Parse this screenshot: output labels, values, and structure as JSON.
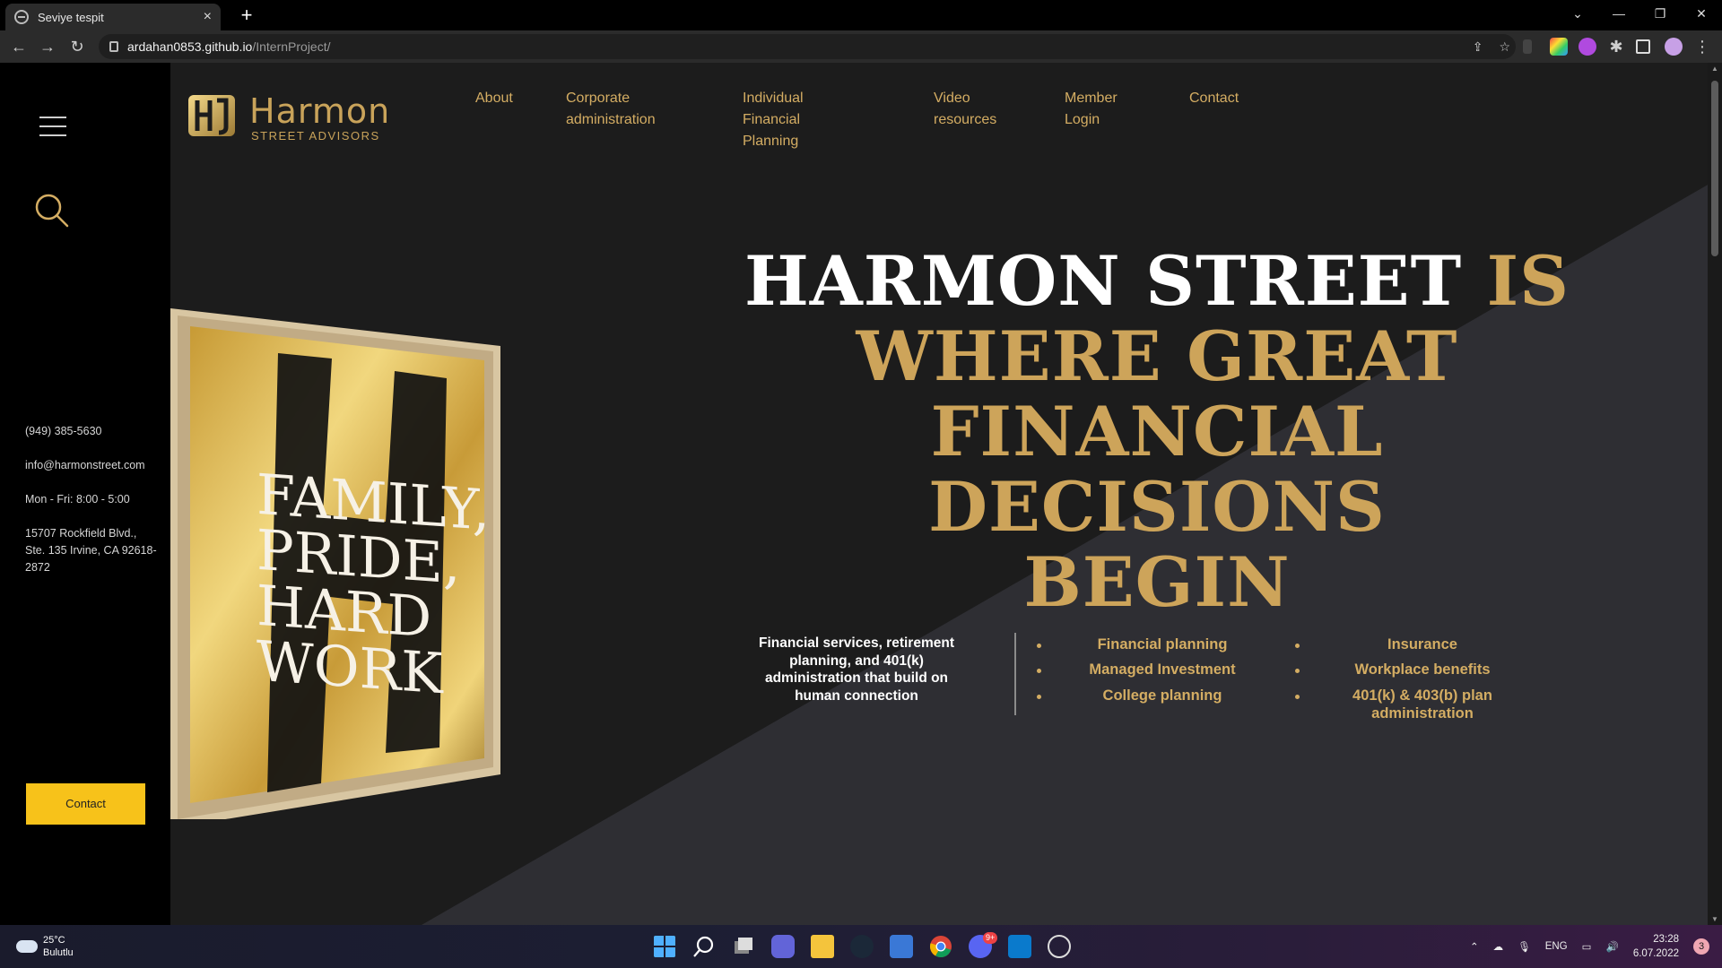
{
  "browser": {
    "tab_title": "Seviye tespit",
    "tab_close": "×",
    "new_tab": "+",
    "url_host": "ardahan0853.github.io",
    "url_path": "/InternProject/"
  },
  "sidebar": {
    "phone": "(949) 385-5630",
    "email": "info@harmonstreet.com",
    "hours": "Mon - Fri: 8:00 - 5:00",
    "address": "15707 Rockfield Blvd., Ste. 135 Irvine, CA 92618-2872",
    "contact_button": "Contact"
  },
  "logo": {
    "name": "Harmon",
    "tagline": "STREET ADVISORS"
  },
  "nav": {
    "about": "About",
    "corporate_l1": "Corporate",
    "corporate_l2": "administration",
    "individual_l1": "Individual Financial",
    "individual_l2": "Planning",
    "video_l1": "Video",
    "video_l2": "resources",
    "member_l1": "Member",
    "member_l2": "Login",
    "contact": "Contact"
  },
  "poster": {
    "line1": "FAMILY,",
    "line2": "PRIDE,",
    "line3": "HARD",
    "line4": "WORK"
  },
  "hero": {
    "white_part": "HARMON STREET",
    "gold_part_1": "IS",
    "gold_line_2": "WHERE GREAT",
    "gold_line_3": "FINANCIAL DECISIONS",
    "gold_line_4": "BEGIN"
  },
  "tagline": "Financial services, retirement planning, and 401(k) administration that build on human connection",
  "services_left": [
    "Financial planning",
    "Managed Investment",
    "College planning"
  ],
  "services_right": [
    "Insurance",
    "Workplace benefits",
    "401(k) & 403(b) plan administration"
  ],
  "taskbar": {
    "temp": "25°C",
    "weather": "Bulutlu",
    "lang": "ENG",
    "time": "23:28",
    "date": "6.07.2022",
    "notifications": "3",
    "discord_badge": "9+"
  },
  "colors": {
    "gold": "#d4ad63",
    "contact_yellow": "#f7c21a",
    "page_bg": "#1c1c1c"
  }
}
